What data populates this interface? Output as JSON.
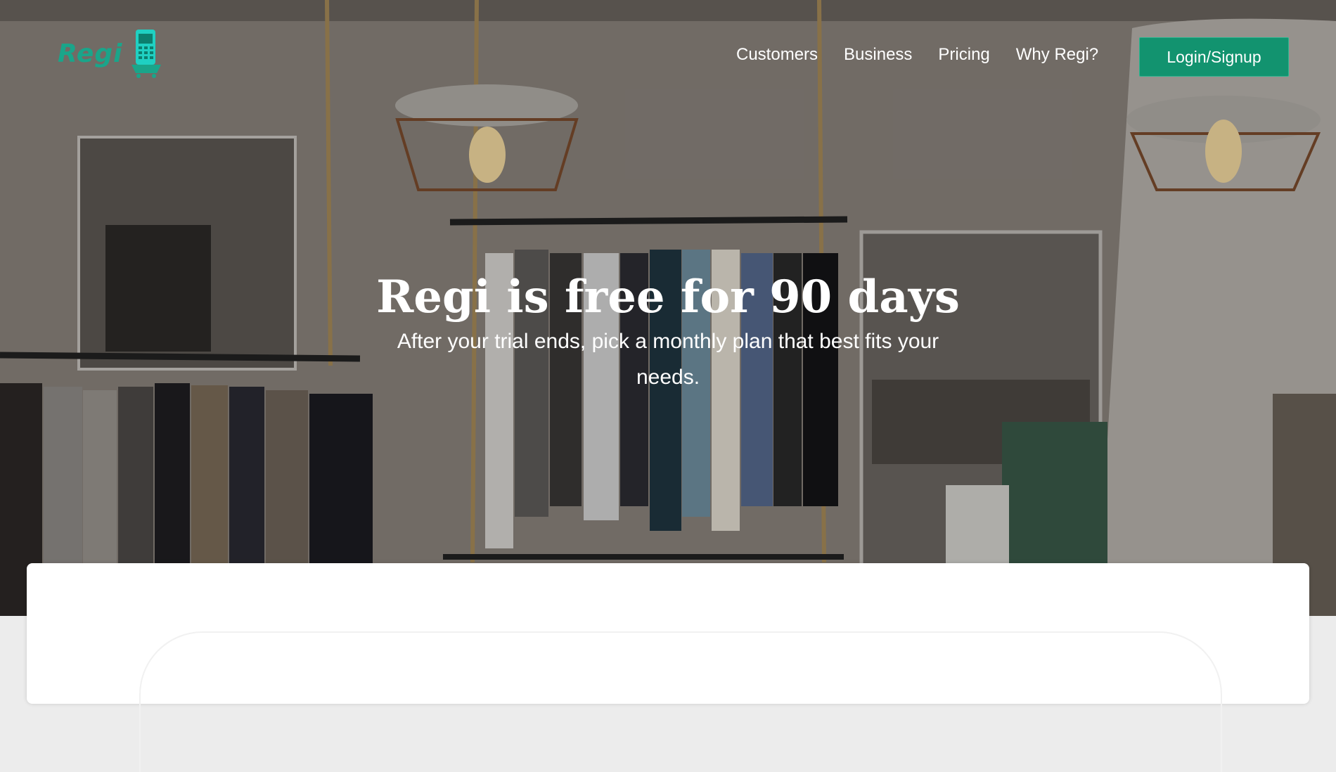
{
  "brand": {
    "logo_text": "Regi",
    "accent": "#1aa58a",
    "button_color": "#12936f"
  },
  "nav": {
    "items": [
      "Customers",
      "Business",
      "Pricing",
      "Why Regi?"
    ],
    "login_label": "Login/Signup"
  },
  "hero": {
    "headline": "Regi is free for 90 days",
    "subtext": "After your trial ends, pick a monthly plan that best fits your needs."
  }
}
